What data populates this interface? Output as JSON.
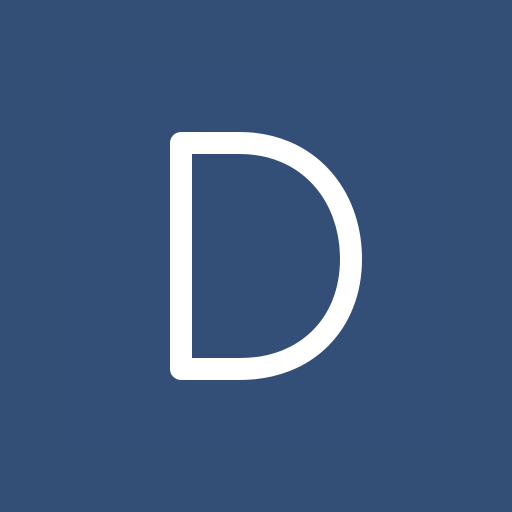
{
  "app_icon": {
    "icon_name": "letter-d-logo-icon",
    "colors": {
      "background": "#344f75",
      "inner_square": "#33507a",
      "glyph": "#ffffff"
    }
  }
}
